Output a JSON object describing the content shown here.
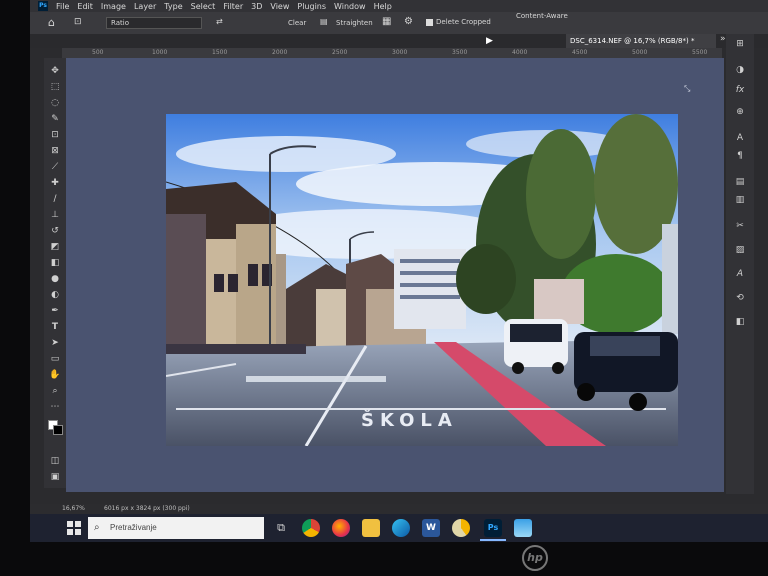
{
  "menu": {
    "items": [
      "File",
      "Edit",
      "Image",
      "Layer",
      "Type",
      "Select",
      "Filter",
      "3D",
      "View",
      "Plugins",
      "Window",
      "Help"
    ]
  },
  "options": {
    "ratio_label": "Ratio",
    "clear_label": "Clear",
    "straighten_label": "Straighten",
    "delete_cropped_label": "Delete Cropped",
    "content_aware_label": "Content-Aware"
  },
  "document": {
    "tab_title": "DSC_6314.NEF @ 16,7% (RGB/8*) *"
  },
  "ruler": {
    "labels": [
      "500",
      "1000",
      "1500",
      "2000",
      "2500",
      "3000",
      "3500",
      "4000",
      "4500",
      "5000",
      "5500"
    ]
  },
  "photo": {
    "road_text": "ŠKOLA"
  },
  "status": {
    "zoom": "16,67%",
    "dimensions": "6016 px x 3824 px (300 ppi)"
  },
  "taskbar": {
    "search_placeholder": "Pretraživanje",
    "apps": [
      "task-view",
      "chrome",
      "firefox",
      "file-explorer",
      "edge",
      "word",
      "chrome-alt",
      "photoshop",
      "photos"
    ]
  },
  "brand": {
    "monitor_logo": "hp"
  },
  "colors": {
    "photoshop_blue": "#31a8ff",
    "pasteboard": "#4a5370",
    "taskbar": "#1e2230"
  }
}
